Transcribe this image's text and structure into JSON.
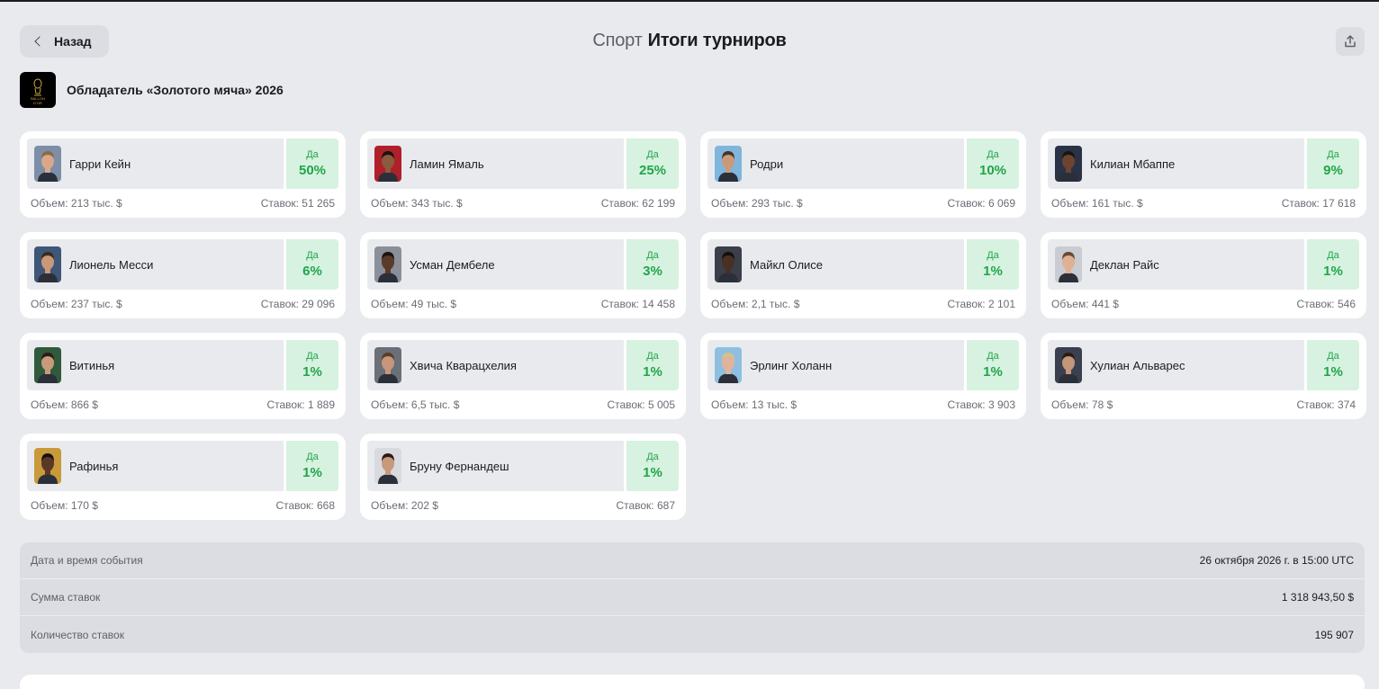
{
  "header": {
    "back_label": "Назад",
    "category": "Спорт",
    "title": "Итоги турниров"
  },
  "event": {
    "title": "Обладатель «Золотого мяча» 2026",
    "logo_text": [
      "BALLON",
      "D'OR"
    ]
  },
  "outcomes": [
    {
      "name": "Гарри Кейн",
      "yes_label": "Да",
      "pct": "50%",
      "volume": "Объем: 213 тыс. $",
      "bets": "Ставок: 51 265",
      "skin": "#d9a88a",
      "hair": "#8a6a4a",
      "bg": "#7d8fa8"
    },
    {
      "name": "Ламин Ямаль",
      "yes_label": "Да",
      "pct": "25%",
      "volume": "Объем: 343 тыс. $",
      "bets": "Ставок: 62 199",
      "skin": "#8c5a3c",
      "hair": "#1a1410",
      "bg": "#b0202a"
    },
    {
      "name": "Родри",
      "yes_label": "Да",
      "pct": "10%",
      "volume": "Объем: 293 тыс. $",
      "bets": "Ставок: 6 069",
      "skin": "#c99a7a",
      "hair": "#4a3426",
      "bg": "#7fb6dd"
    },
    {
      "name": "Килиан Мбаппе",
      "yes_label": "Да",
      "pct": "9%",
      "volume": "Объем: 161 тыс. $",
      "bets": "Ставок: 17 618",
      "skin": "#6b4430",
      "hair": "#1a1410",
      "bg": "#2a3246"
    },
    {
      "name": "Лионель Месси",
      "yes_label": "Да",
      "pct": "6%",
      "volume": "Объем: 237 тыс. $",
      "bets": "Ставок: 29 096",
      "skin": "#c89878",
      "hair": "#3a2a1e",
      "bg": "#3e5778"
    },
    {
      "name": "Усман Дембеле",
      "yes_label": "Да",
      "pct": "3%",
      "volume": "Объем: 49 тыс. $",
      "bets": "Ставок: 14 458",
      "skin": "#5a3a28",
      "hair": "#1a1410",
      "bg": "#8a8f99"
    },
    {
      "name": "Майкл Олисе",
      "yes_label": "Да",
      "pct": "1%",
      "volume": "Объем: 2,1 тыс. $",
      "bets": "Ставок: 2 101",
      "skin": "#4a3024",
      "hair": "#140f0c",
      "bg": "#3a3f4a"
    },
    {
      "name": "Деклан Райс",
      "yes_label": "Да",
      "pct": "1%",
      "volume": "Объем: 441 $",
      "bets": "Ставок: 546",
      "skin": "#e0b095",
      "hair": "#6a4a30",
      "bg": "#c9ccd2"
    },
    {
      "name": "Витинья",
      "yes_label": "Да",
      "pct": "1%",
      "volume": "Объем: 866 $",
      "bets": "Ставок: 1 889",
      "skin": "#c89a7c",
      "hair": "#2a1c14",
      "bg": "#2f5a3c"
    },
    {
      "name": "Хвича Кварацхелия",
      "yes_label": "Да",
      "pct": "1%",
      "volume": "Объем: 6,5 тыс. $",
      "bets": "Ставок: 5 005",
      "skin": "#c8967a",
      "hair": "#5a3e28",
      "bg": "#6a6f78"
    },
    {
      "name": "Эрлинг Холанн",
      "yes_label": "Да",
      "pct": "1%",
      "volume": "Объем: 13 тыс. $",
      "bets": "Ставок: 3 903",
      "skin": "#e0b49a",
      "hair": "#d6c08a",
      "bg": "#8fbfe0"
    },
    {
      "name": "Хулиан Альварес",
      "yes_label": "Да",
      "pct": "1%",
      "volume": "Объем: 78 $",
      "bets": "Ставок: 374",
      "skin": "#c4967a",
      "hair": "#2a1c14",
      "bg": "#3a4050"
    },
    {
      "name": "Рафинья",
      "yes_label": "Да",
      "pct": "1%",
      "volume": "Объем: 170 $",
      "bets": "Ставок: 668",
      "skin": "#5a3826",
      "hair": "#141010",
      "bg": "#c89a3a"
    },
    {
      "name": "Бруну Фернандеш",
      "yes_label": "Да",
      "pct": "1%",
      "volume": "Объем: 202 $",
      "bets": "Ставок: 687",
      "skin": "#c89a7c",
      "hair": "#2a1c14",
      "bg": "#d8dade"
    }
  ],
  "info": [
    {
      "label": "Дата и время события",
      "value": "26 октября 2026 г. в 15:00 UTC"
    },
    {
      "label": "Сумма ставок",
      "value": "1 318 943,50 $"
    },
    {
      "label": "Количество ставок",
      "value": "195 907"
    }
  ],
  "colors": {
    "accent_green": "#21a54a",
    "yes_bg": "#d7f2e0",
    "page_bg": "#e9eaee"
  }
}
